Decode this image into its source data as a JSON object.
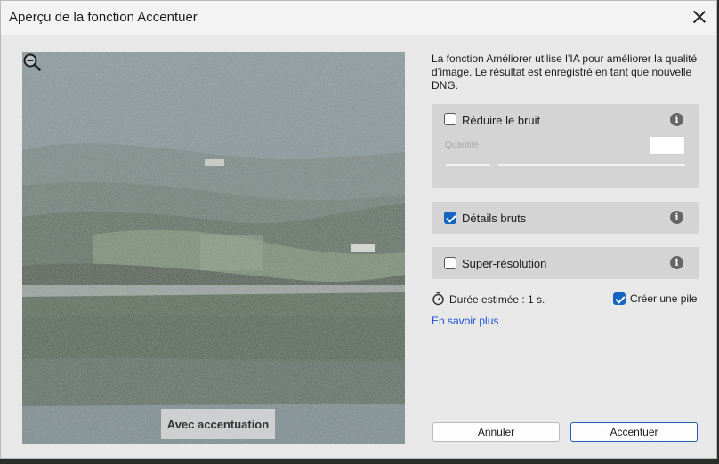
{
  "dialog": {
    "title": "Aperçu de la fonction Accentuer",
    "description": "La fonction Améliorer utilise l’IA pour améliorer la qualité d’image. Le résultat est enregistré en tant que nouvelle DNG."
  },
  "preview": {
    "label": "Avec accentuation",
    "zoom_icon": "zoom-out-icon"
  },
  "options": {
    "noise": {
      "label": "Réduire le bruit",
      "checked": false,
      "quantity_label": "Quantité",
      "quantity_value": ""
    },
    "raw_details": {
      "label": "Détails bruts",
      "checked": true
    },
    "super_resolution": {
      "label": "Super-résolution",
      "checked": false
    }
  },
  "footer": {
    "duration": "Durée estimée : 1 s.",
    "create_stack": {
      "label": "Créer une pile",
      "checked": true
    },
    "learn_more": "En savoir plus",
    "cancel": "Annuler",
    "enhance": "Accentuer"
  },
  "colors": {
    "accent": "#1565c0",
    "link": "#1a4fd6"
  }
}
